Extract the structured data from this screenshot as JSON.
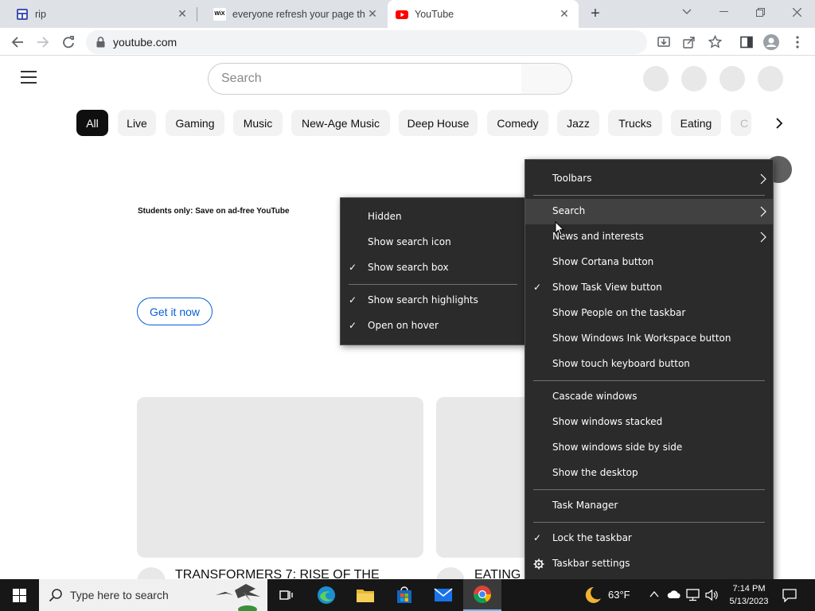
{
  "browser": {
    "tabs": [
      {
        "title": "rip",
        "favicon": "page-layout-icon"
      },
      {
        "title": "everyone refresh your page the w",
        "favicon": "wix-icon",
        "favicon_text": "WiX"
      },
      {
        "title": "YouTube",
        "favicon": "youtube-icon"
      }
    ],
    "new_tab_label": "+",
    "address": "youtube.com"
  },
  "youtube": {
    "search_placeholder": "Search",
    "chips": [
      "All",
      "Live",
      "Gaming",
      "Music",
      "New-Age Music",
      "Deep House",
      "Comedy",
      "Jazz",
      "Trucks",
      "Eating",
      "C"
    ],
    "promo_text": "Students only:  Save on ad-free YouTube",
    "promo_button": "Get it now",
    "videos": [
      {
        "title": "TRANSFORMERS 7: RISE OF THE"
      },
      {
        "title": "EATING"
      }
    ]
  },
  "context_menu": {
    "items": [
      {
        "label": "Toolbars",
        "submenu": true
      },
      {
        "label": "Search",
        "submenu": true,
        "highlighted": true
      },
      {
        "label": "News and interests",
        "submenu": true
      },
      {
        "label": "Show Cortana button"
      },
      {
        "label": "Show Task View button",
        "checked": true
      },
      {
        "label": "Show People on the taskbar"
      },
      {
        "label": "Show Windows Ink Workspace button"
      },
      {
        "label": "Show touch keyboard button"
      },
      {
        "label": "Cascade windows"
      },
      {
        "label": "Show windows stacked"
      },
      {
        "label": "Show windows side by side"
      },
      {
        "label": "Show the desktop"
      },
      {
        "label": "Task Manager"
      },
      {
        "label": "Lock the taskbar",
        "checked": true
      },
      {
        "label": "Taskbar settings",
        "icon": "gear-icon"
      }
    ]
  },
  "search_submenu": {
    "items": [
      {
        "label": "Hidden"
      },
      {
        "label": "Show search icon"
      },
      {
        "label": "Show search box",
        "checked": true
      },
      {
        "label": "Show search highlights",
        "checked": true
      },
      {
        "label": "Open on hover",
        "checked": true
      }
    ]
  },
  "taskbar": {
    "search_placeholder": "Type here to search",
    "weather": "63°F",
    "time": "7:14 PM",
    "date": "5/13/2023"
  },
  "colors": {
    "menu_bg": "#2b2b2b",
    "menu_highlight": "#414141",
    "youtube_red": "#ff0000",
    "link_blue": "#065fd4",
    "chrome_tabbar": "#dee1e6"
  }
}
